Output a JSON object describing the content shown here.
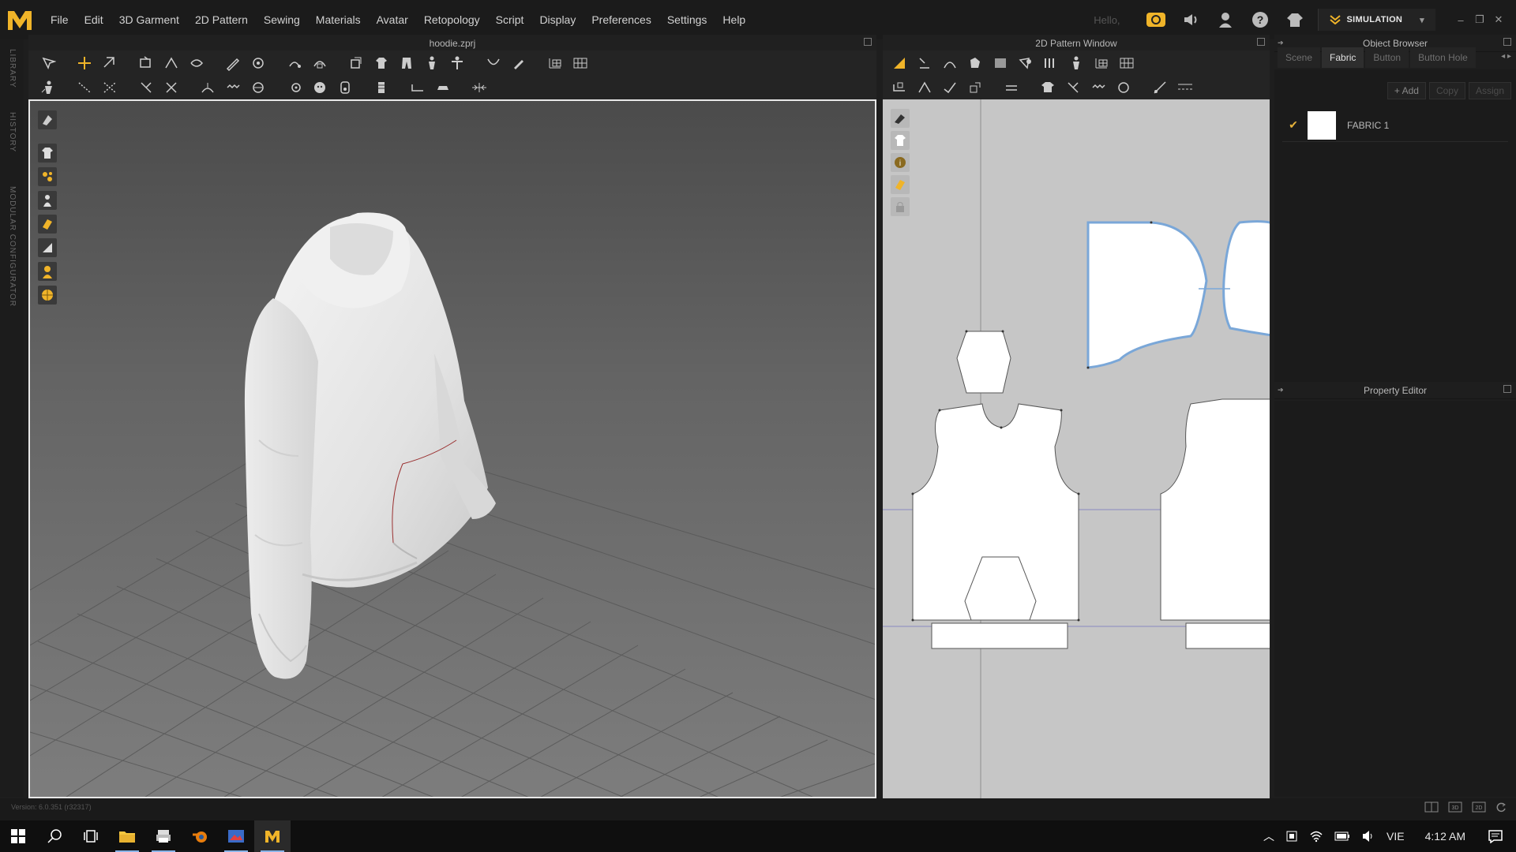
{
  "menu": {
    "items": [
      "File",
      "Edit",
      "3D Garment",
      "2D Pattern",
      "Sewing",
      "Materials",
      "Avatar",
      "Retopology",
      "Script",
      "Display",
      "Preferences",
      "Settings",
      "Help"
    ],
    "hello": "Hello,",
    "simulation_label": "SIMULATION"
  },
  "panels": {
    "viewport3d_title": "hoodie.zprj",
    "pattern_title": "2D Pattern Window",
    "object_browser_title": "Object Browser",
    "property_editor_title": "Property Editor"
  },
  "left_strip": [
    "LIBRARY",
    "HISTORY",
    "MODULAR CONFIGURATOR"
  ],
  "object_browser": {
    "tabs": [
      "Scene",
      "Fabric",
      "Button",
      "Button Hole"
    ],
    "active_tab": "Fabric",
    "buttons": {
      "add": "+ Add",
      "copy": "Copy",
      "assign": "Assign"
    },
    "fabrics": [
      {
        "name": "FABRIC 1",
        "selected": true,
        "color": "#ffffff"
      }
    ]
  },
  "status": {
    "version": "Version: 6.0.351 (r32317)"
  },
  "taskbar": {
    "language": "VIE",
    "time": "4:12 AM"
  },
  "colors": {
    "accent": "#e6b23a",
    "viewport_border": "#e8e8e8",
    "pattern_bg": "#c6c6c6",
    "selected_outline": "#7aa7d8"
  }
}
